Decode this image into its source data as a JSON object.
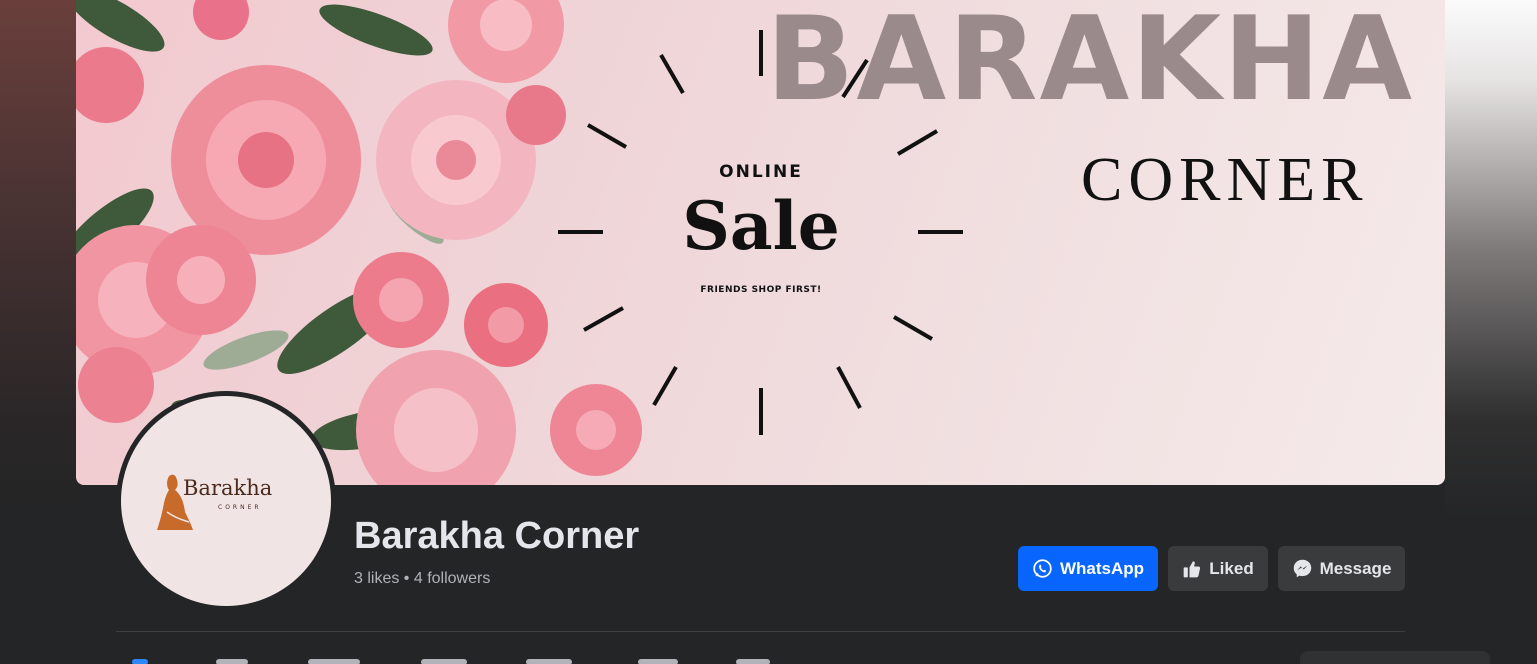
{
  "cover": {
    "brand_title": "BARAKHA",
    "brand_subtitle": "CORNER",
    "sale_top": "ONLINE",
    "sale_main": "Sale",
    "sale_tagline": "FRIENDS SHOP FIRST!"
  },
  "profile": {
    "logo_name": "Barakha",
    "logo_sub": "CORNER",
    "page_name": "Barakha Corner",
    "stats": "3 likes • 4 followers"
  },
  "actions": {
    "whatsapp_label": "WhatsApp",
    "liked_label": "Liked",
    "message_label": "Message",
    "whatsapp_color": "#0866ff",
    "secondary_color": "#3a3b3c"
  },
  "icons": {
    "whatsapp": "whatsapp-icon",
    "liked": "thumbs-up-icon",
    "message": "messenger-icon"
  }
}
